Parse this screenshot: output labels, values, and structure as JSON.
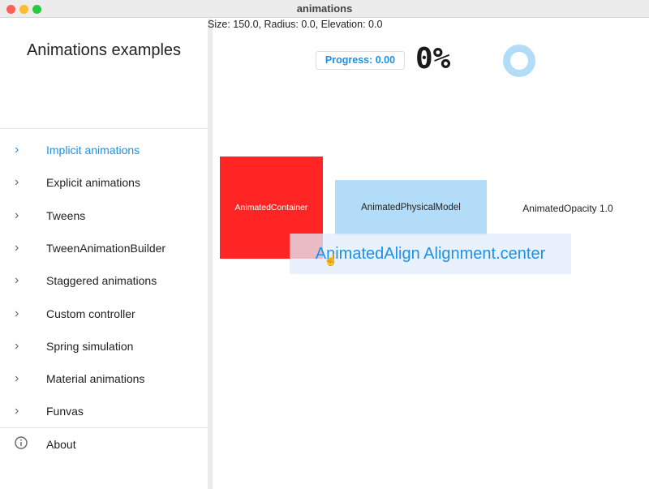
{
  "window": {
    "title": "animations"
  },
  "sidebar": {
    "title": "Animations examples",
    "items": [
      {
        "label": "Implicit animations",
        "active": true
      },
      {
        "label": "Explicit animations"
      },
      {
        "label": "Tweens"
      },
      {
        "label": "TweenAnimationBuilder"
      },
      {
        "label": "Staggered animations"
      },
      {
        "label": "Custom controller"
      },
      {
        "label": "Spring simulation"
      },
      {
        "label": "Material animations"
      },
      {
        "label": "Funvas"
      }
    ],
    "about": "About"
  },
  "main": {
    "status": "Size: 150.0, Radius: 0.0, Elevation: 0.0",
    "progress_button": "Progress: 0.00",
    "percent": "0%",
    "progress_value": 0.0,
    "container_label": "AnimatedContainer",
    "physical_label": "AnimatedPhysicalModel",
    "opacity_label": "AnimatedOpacity 1.0",
    "align_label": "AnimatedAlign Alignment.center"
  },
  "colors": {
    "accent": "#1e90e6",
    "container": "#ff2525",
    "physical": "#b3dcf8",
    "ring": "#b3dcf8"
  }
}
